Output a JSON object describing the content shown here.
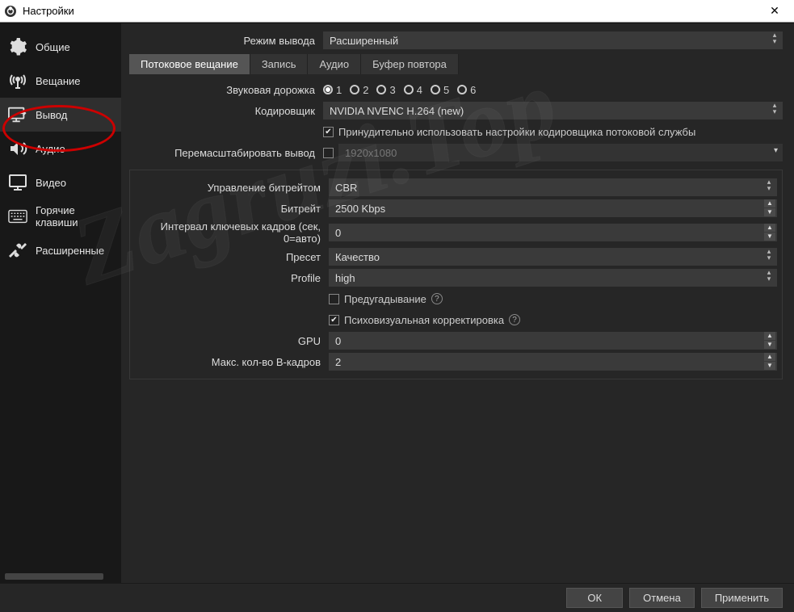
{
  "title": "Настройки",
  "sidebar": {
    "items": [
      {
        "label": "Общие"
      },
      {
        "label": "Вещание"
      },
      {
        "label": "Вывод"
      },
      {
        "label": "Аудио"
      },
      {
        "label": "Видео"
      },
      {
        "label": "Горячие клавиши"
      },
      {
        "label": "Расширенные"
      }
    ]
  },
  "output_mode_label": "Режим вывода",
  "output_mode_value": "Расширенный",
  "tabs": [
    {
      "label": "Потоковое вещание"
    },
    {
      "label": "Запись"
    },
    {
      "label": "Аудио"
    },
    {
      "label": "Буфер повтора"
    }
  ],
  "audio_track_label": "Звуковая дорожка",
  "audio_tracks": [
    "1",
    "2",
    "3",
    "4",
    "5",
    "6"
  ],
  "encoder_label": "Кодировщик",
  "encoder_value": "NVIDIA NVENC H.264 (new)",
  "enforce_label": "Принудительно использовать настройки кодировщика потоковой службы",
  "rescale_label": "Перемасштабировать вывод",
  "rescale_value": "1920x1080",
  "rate_control_label": "Управление битрейтом",
  "rate_control_value": "CBR",
  "bitrate_label": "Битрейт",
  "bitrate_value": "2500 Kbps",
  "keyint_label": "Интервал ключевых кадров (сек, 0=авто)",
  "keyint_value": "0",
  "preset_label": "Пресет",
  "preset_value": "Качество",
  "profile_label": "Profile",
  "profile_value": "high",
  "lookahead_label": "Предугадывание",
  "psycho_label": "Психовизуальная корректировка",
  "gpu_label": "GPU",
  "gpu_value": "0",
  "bframes_label": "Макс. кол-во B-кадров",
  "bframes_value": "2",
  "footer": {
    "ok": "ОК",
    "cancel": "Отмена",
    "apply": "Применить"
  },
  "watermark": "Zagruzi.Top"
}
